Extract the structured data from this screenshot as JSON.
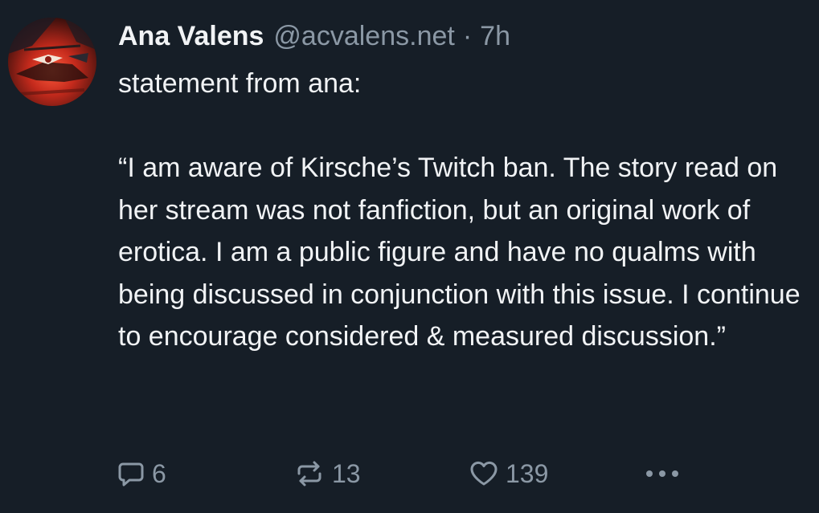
{
  "post": {
    "author_name": "Ana Valens",
    "author_handle": "@acvalens.net",
    "separator": "·",
    "timestamp": "7h",
    "paragraphs": [
      "statement from ana:",
      "“I am aware of Kirsche’s Twitch ban. The story read on her stream was not fanfiction, but an original work of erotica. I am a public figure and have no qualms with being discussed in conjunction with this issue. I continue to encourage considered & measured discussion.”"
    ],
    "actions": {
      "reply_count": "6",
      "repost_count": "13",
      "like_count": "139"
    },
    "icons": {
      "reply": "speech-bubble-icon",
      "repost": "repost-arrows-icon",
      "like": "heart-icon",
      "more": "ellipsis-icon"
    },
    "colors": {
      "background": "#161e27",
      "text": "#f1f3f5",
      "muted": "#8b98a5"
    }
  }
}
